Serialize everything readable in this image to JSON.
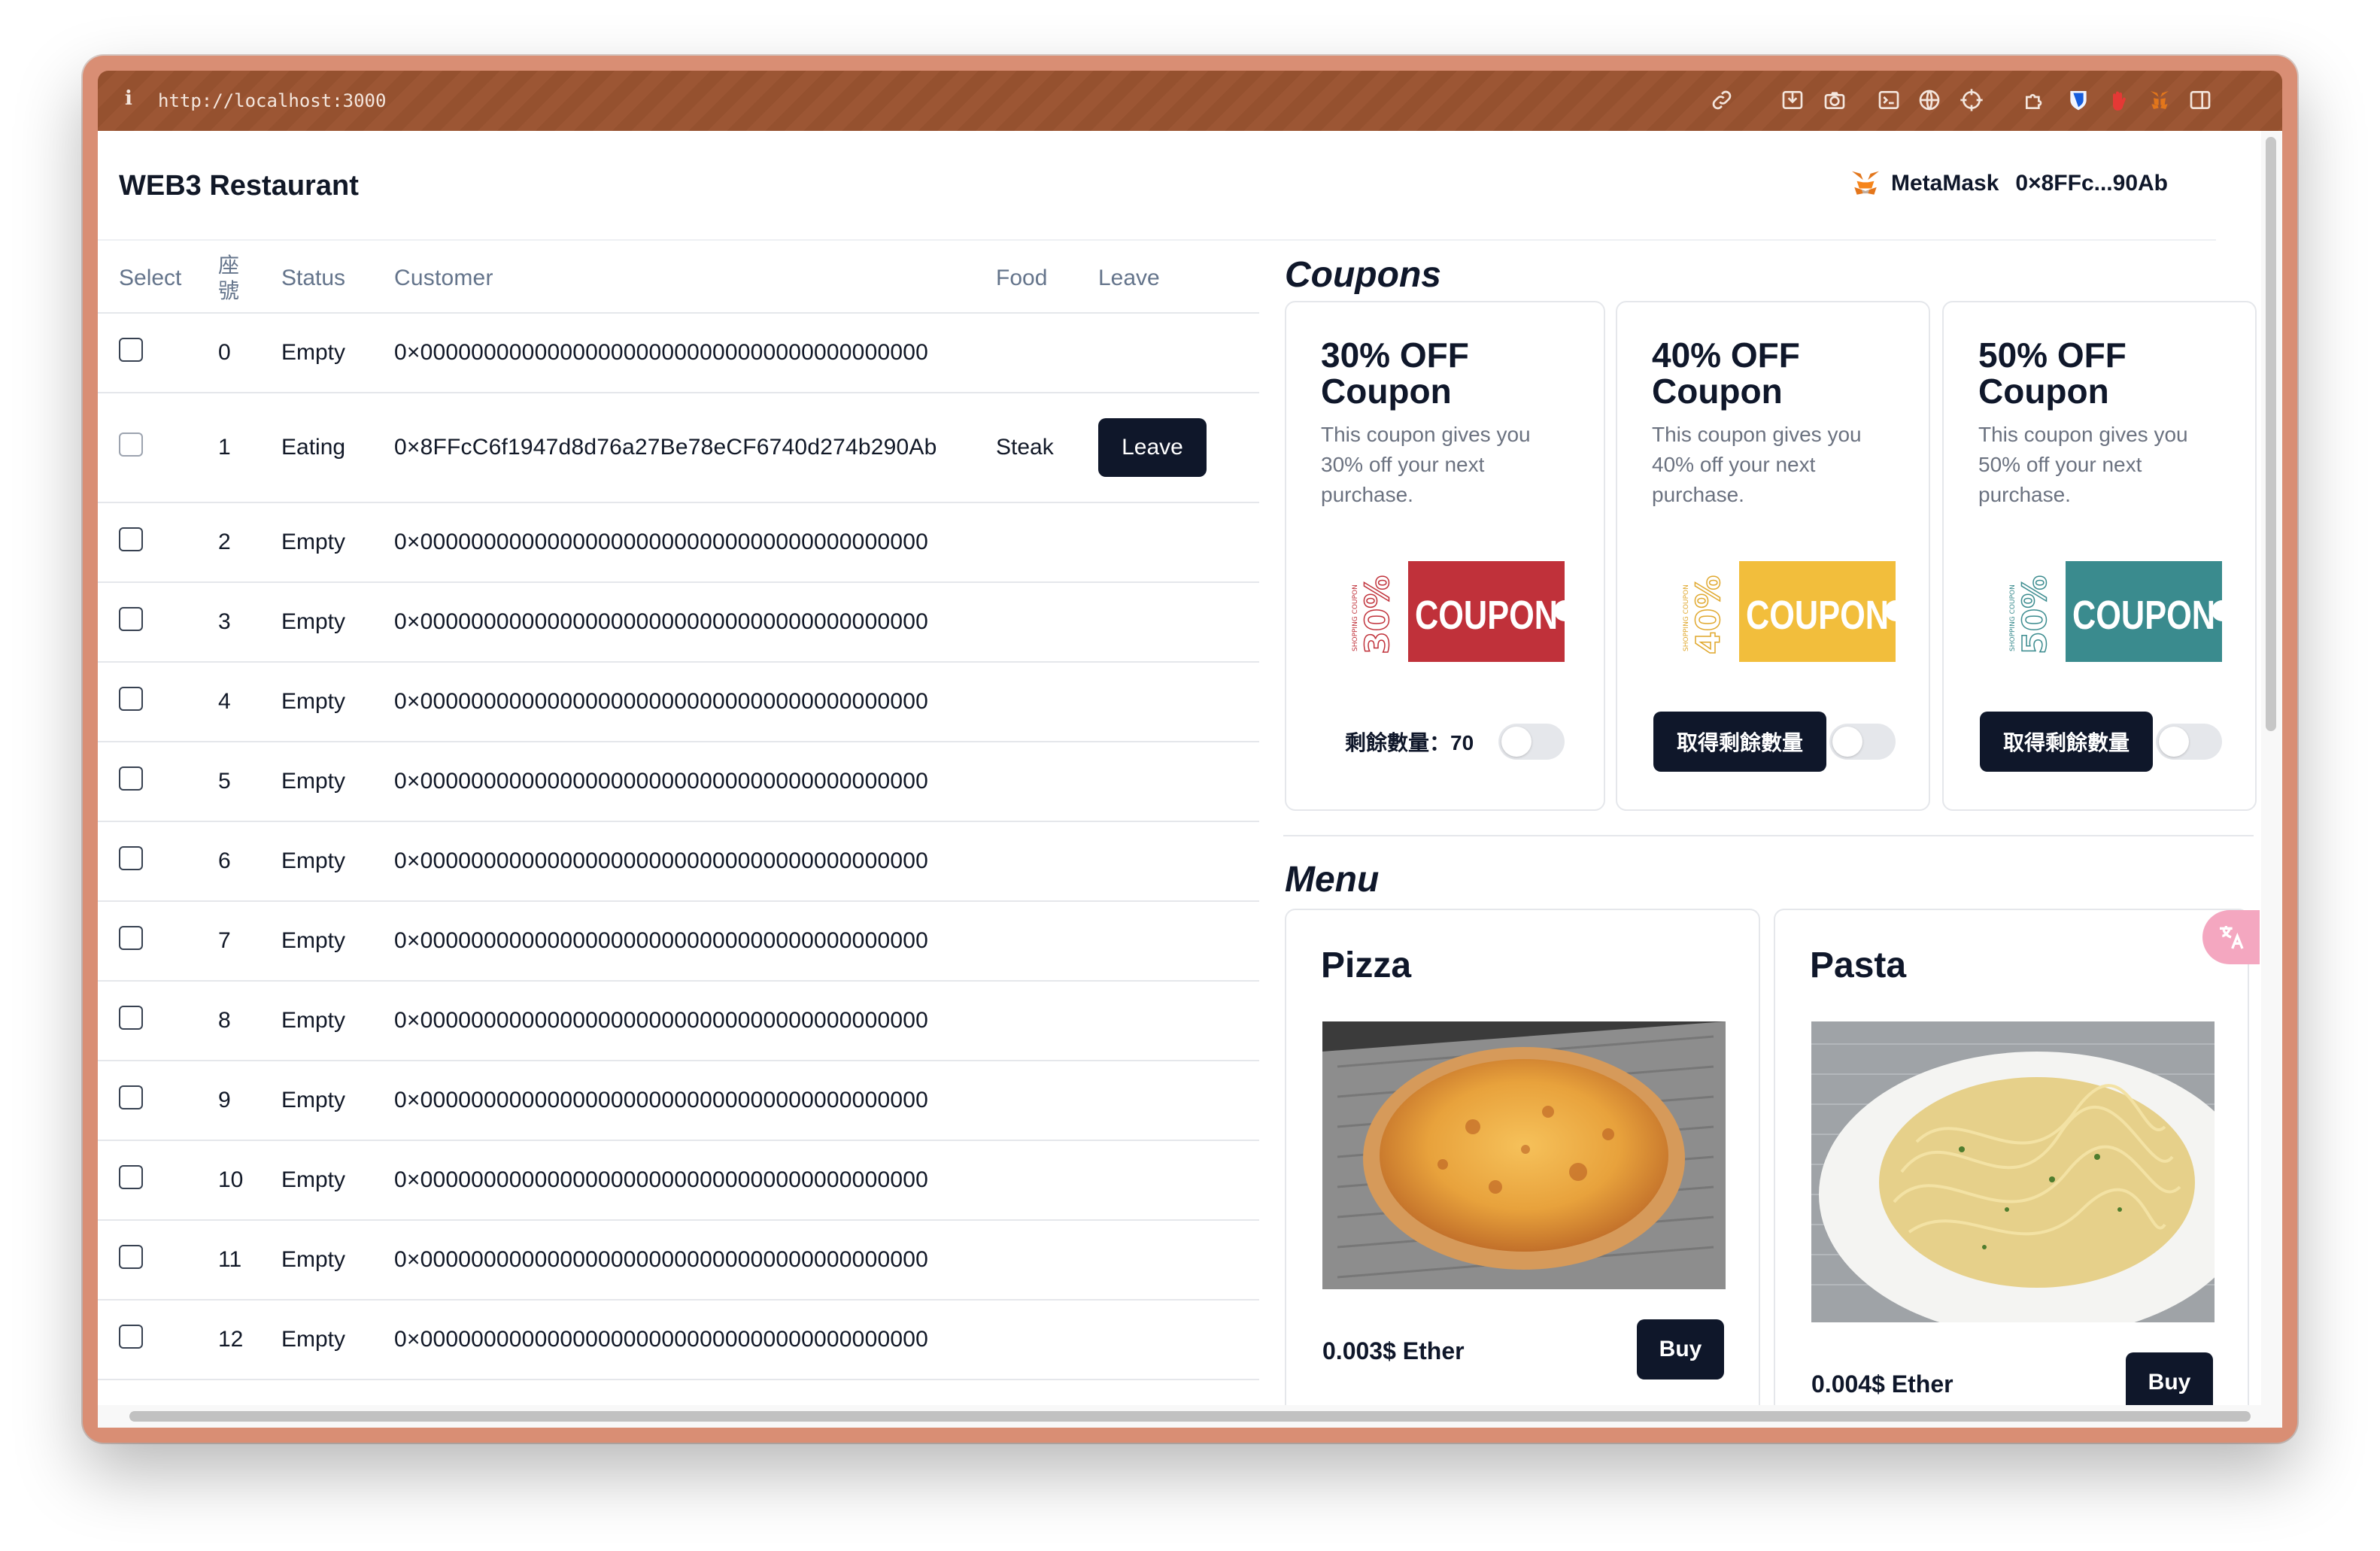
{
  "browser": {
    "url": "http://localhost:3000",
    "info_icon": "i",
    "toolbar_icons": [
      "link-icon",
      "save-icon",
      "camera-icon",
      "terminal-icon",
      "globe-icon",
      "crosshair-icon",
      "extension-icon",
      "bitwarden-icon",
      "hand-icon",
      "metamask-fox-icon",
      "sidebar-icon"
    ]
  },
  "header": {
    "brand": "WEB3 Restaurant",
    "wallet_name": "MetaMask",
    "wallet_address": "0×8FFc...90Ab"
  },
  "table": {
    "headers": {
      "select": "Select",
      "seat": "座號",
      "status": "Status",
      "customer": "Customer",
      "food": "Food",
      "leave": "Leave"
    },
    "rows": [
      {
        "seat": "0",
        "status": "Empty",
        "customer": "0×0000000000000000000000000000000000000000",
        "food": "",
        "leave": ""
      },
      {
        "seat": "1",
        "status": "Eating",
        "customer": "0×8FFcC6f1947d8d76a27Be78eCF6740d274b290Ab",
        "food": "Steak",
        "leave": "Leave"
      },
      {
        "seat": "2",
        "status": "Empty",
        "customer": "0×0000000000000000000000000000000000000000",
        "food": "",
        "leave": ""
      },
      {
        "seat": "3",
        "status": "Empty",
        "customer": "0×0000000000000000000000000000000000000000",
        "food": "",
        "leave": ""
      },
      {
        "seat": "4",
        "status": "Empty",
        "customer": "0×0000000000000000000000000000000000000000",
        "food": "",
        "leave": ""
      },
      {
        "seat": "5",
        "status": "Empty",
        "customer": "0×0000000000000000000000000000000000000000",
        "food": "",
        "leave": ""
      },
      {
        "seat": "6",
        "status": "Empty",
        "customer": "0×0000000000000000000000000000000000000000",
        "food": "",
        "leave": ""
      },
      {
        "seat": "7",
        "status": "Empty",
        "customer": "0×0000000000000000000000000000000000000000",
        "food": "",
        "leave": ""
      },
      {
        "seat": "8",
        "status": "Empty",
        "customer": "0×0000000000000000000000000000000000000000",
        "food": "",
        "leave": ""
      },
      {
        "seat": "9",
        "status": "Empty",
        "customer": "0×0000000000000000000000000000000000000000",
        "food": "",
        "leave": ""
      },
      {
        "seat": "10",
        "status": "Empty",
        "customer": "0×0000000000000000000000000000000000000000",
        "food": "",
        "leave": ""
      },
      {
        "seat": "11",
        "status": "Empty",
        "customer": "0×0000000000000000000000000000000000000000",
        "food": "",
        "leave": ""
      },
      {
        "seat": "12",
        "status": "Empty",
        "customer": "0×0000000000000000000000000000000000000000",
        "food": "",
        "leave": ""
      }
    ]
  },
  "coupons": {
    "title": "Coupons",
    "items": [
      {
        "title": "30% OFF Coupon",
        "desc": "This coupon gives you 30% off your next purchase.",
        "ticket_text": "COUPON",
        "ticket_percent": "30%",
        "ticket_color": "#c0313a",
        "remaining": "剩餘數量：70",
        "action": ""
      },
      {
        "title": "40% OFF Coupon",
        "desc": "This coupon gives you 40% off your next purchase.",
        "ticket_text": "COUPON",
        "ticket_percent": "40%",
        "ticket_color": "#f2be3c",
        "remaining": "",
        "action": "取得剩餘數量"
      },
      {
        "title": "50% OFF Coupon",
        "desc": "This coupon gives you 50% off your next purchase.",
        "ticket_text": "COUPON",
        "ticket_percent": "50%",
        "ticket_color": "#3a8b8e",
        "remaining": "",
        "action": "取得剩餘數量"
      }
    ]
  },
  "menu": {
    "title": "Menu",
    "items": [
      {
        "name": "Pizza",
        "price": "0.003$ Ether",
        "buy": "Buy"
      },
      {
        "name": "Pasta",
        "price": "0.004$ Ether",
        "buy": "Buy"
      }
    ]
  },
  "colors": {
    "primary": "#0f172a",
    "frame": "#d98e74",
    "titlebar": "#95512f"
  }
}
